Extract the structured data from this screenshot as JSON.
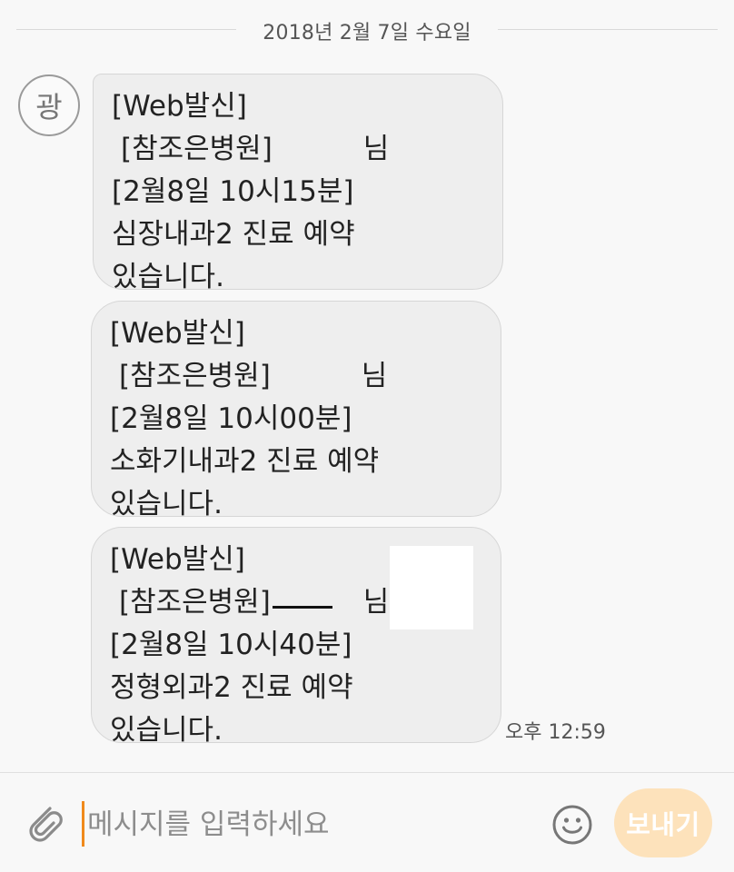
{
  "date_header": "2018년 2월 7일 수요일",
  "sender": {
    "avatar_letter": "광"
  },
  "messages": [
    {
      "line1": "[Web발신]",
      "line2_prefix": "[참조은병원]",
      "line2_suffix": "님",
      "line3": "[2월8일 10시15분]",
      "line4": "심장내과2 진료 예약",
      "line5": "있습니다."
    },
    {
      "line1": "[Web발신]",
      "line2_prefix": "[참조은병원]",
      "line2_suffix": "님",
      "line3": "[2월8일 10시00분]",
      "line4": "소화기내과2 진료 예약",
      "line5": "있습니다."
    },
    {
      "line1": "[Web발신]",
      "line2_prefix": "[참조은병원]",
      "line2_suffix": "님",
      "line3": "[2월8일 10시40분]",
      "line4": "정형외과2 진료 예약",
      "line5": "있습니다."
    }
  ],
  "timestamp": "오후 12:59",
  "composer": {
    "placeholder": "메시지를 입력하세요",
    "value": "",
    "send_label": "보내기",
    "icons": {
      "attach": "paperclip-icon",
      "emoji": "smiley-icon"
    }
  },
  "colors": {
    "background": "#f8f8f8",
    "bubble": "#eeeeee",
    "cursor": "#f08a1c",
    "send_button": "#fde2bb"
  }
}
